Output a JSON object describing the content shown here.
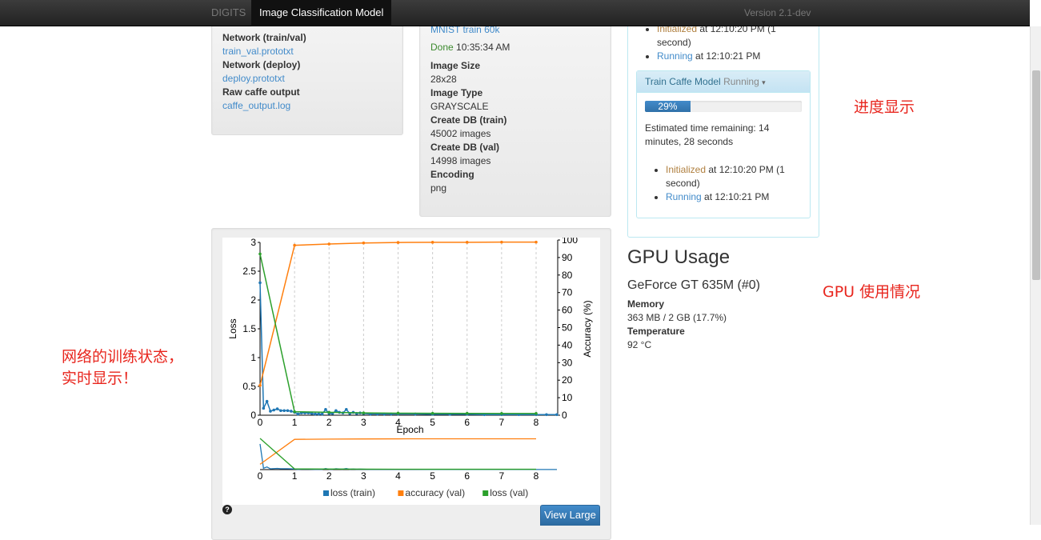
{
  "topbar": {
    "brand": "DIGITS",
    "active_tab": "Image Classification Model",
    "version": "Version 2.1-dev"
  },
  "left_panel": {
    "items": [
      {
        "label": "Network (train/val)",
        "value": "train_val.prototxt"
      },
      {
        "label": "Network (deploy)",
        "value": "deploy.prototxt"
      },
      {
        "label": "Raw caffe output",
        "value": "caffe_output.log"
      }
    ]
  },
  "middle_panel": {
    "dataset_link": "MNIST train 60k",
    "status": "Done",
    "status_time": "10:35:34 AM",
    "items": [
      {
        "label": "Image Size",
        "value": "28x28"
      },
      {
        "label": "Image Type",
        "value": "GRAYSCALE"
      },
      {
        "label": "Create DB (train)",
        "value": "45002 images"
      },
      {
        "label": "Create DB (val)",
        "value": "14998 images"
      },
      {
        "label": "Encoding",
        "value": "png"
      }
    ]
  },
  "right_panel": {
    "top_events": [
      {
        "state": "Initialized",
        "text": " at 12:10:20 PM (1 second)"
      },
      {
        "state": "Running",
        "text": " at 12:10:21 PM"
      }
    ],
    "task": {
      "title": "Train Caffe Model",
      "status": "Running",
      "caret": "▾",
      "progress_percent": 29,
      "progress_label": "29%",
      "eta": "Estimated time remaining: 14 minutes, 28 seconds",
      "events": [
        {
          "state": "Initialized",
          "text": " at 12:10:20 PM (1 second)"
        },
        {
          "state": "Running",
          "text": " at 12:10:21 PM"
        }
      ]
    }
  },
  "gpu": {
    "heading": "GPU Usage",
    "device": "GeForce GT 635M (#0)",
    "memory_label": "Memory",
    "memory_value": "363 MB / 2 GB (17.7%)",
    "temperature_label": "Temperature",
    "temperature_value": "92 °C"
  },
  "annotations": {
    "progress": "进度显示",
    "gpu": "GPU 使用情况",
    "training_line1": "网络的训练状态，",
    "training_line2": "实时显示！"
  },
  "chart_buttons": {
    "view_large": "View Large",
    "help_icon": "question-circle-icon"
  },
  "colors": {
    "loss_train": "#1f77b4",
    "accuracy_val": "#ff7f0e",
    "loss_val": "#2ca02c",
    "accent": "#428bca"
  },
  "chart_data": {
    "type": "line",
    "xlabel": "Epoch",
    "ylabel": "Loss",
    "y2label": "Accuracy (%)",
    "xlim": [
      0,
      8.6
    ],
    "ylim": [
      0,
      3
    ],
    "y2lim": [
      0,
      100
    ],
    "xticks": [
      0,
      1,
      2,
      3,
      4,
      5,
      6,
      7,
      8
    ],
    "yticks": [
      0,
      0.5,
      1,
      1.5,
      2,
      2.5,
      3
    ],
    "y2ticks": [
      0,
      10,
      20,
      30,
      40,
      50,
      60,
      70,
      80,
      90,
      100
    ],
    "grid": "vertical dashed",
    "legend": "bottom",
    "series": [
      {
        "name": "loss (train)",
        "axis": "y",
        "x": [
          0,
          0.1,
          0.2,
          0.3,
          0.4,
          0.5,
          0.6,
          0.7,
          0.8,
          0.9,
          1.0,
          1.1,
          1.2,
          1.3,
          1.4,
          1.5,
          1.6,
          1.7,
          1.8,
          1.9,
          2.0,
          2.1,
          2.2,
          2.3,
          2.4,
          2.5,
          2.6,
          2.7,
          2.8,
          2.9,
          3.0,
          3.2,
          3.4,
          3.6,
          3.8,
          4.0,
          4.5,
          5.0,
          5.5,
          6.0,
          6.5,
          7.0,
          7.5,
          8.0,
          8.3,
          8.6
        ],
        "y": [
          2.3,
          0.12,
          0.24,
          0.07,
          0.09,
          0.11,
          0.08,
          0.08,
          0.08,
          0.07,
          0.05,
          0.02,
          0.04,
          0.04,
          0.04,
          0.03,
          0.02,
          0.02,
          0.02,
          0.1,
          0.03,
          0.03,
          0.08,
          0.05,
          0.04,
          0.1,
          0.03,
          0.05,
          0.03,
          0.04,
          0.03,
          0.02,
          0.02,
          0.02,
          0.02,
          0.02,
          0.02,
          0.015,
          0.015,
          0.015,
          0.01,
          0.01,
          0.01,
          0.01,
          0.01,
          0.01
        ]
      },
      {
        "name": "accuracy (val)",
        "axis": "y2",
        "x": [
          0,
          1,
          2,
          3,
          4,
          5,
          6,
          7,
          8
        ],
        "y": [
          17,
          97,
          97.7,
          98.3,
          98.6,
          98.7,
          98.7,
          98.8,
          98.8
        ]
      },
      {
        "name": "loss (val)",
        "axis": "y",
        "x": [
          0,
          1,
          2,
          3,
          4,
          5,
          6,
          7,
          8
        ],
        "y": [
          2.8,
          0.06,
          0.05,
          0.04,
          0.035,
          0.033,
          0.032,
          0.03,
          0.03
        ]
      }
    ]
  }
}
